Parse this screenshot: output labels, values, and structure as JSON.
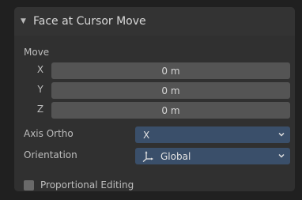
{
  "panel": {
    "title": "Face at Cursor Move",
    "collapse_icon": "disclosure-triangle-down-icon",
    "move": {
      "label": "Move",
      "axes": [
        {
          "label": "X",
          "value": "0 m"
        },
        {
          "label": "Y",
          "value": "0 m"
        },
        {
          "label": "Z",
          "value": "0 m"
        }
      ]
    },
    "axis_ortho": {
      "label": "Axis Ortho",
      "value": "X"
    },
    "orientation": {
      "label": "Orientation",
      "value": "Global",
      "icon": "global-axes-icon"
    },
    "proportional_editing": {
      "label": "Proportional Editing",
      "checked": false
    }
  },
  "colors": {
    "background": "#202020",
    "panel": "#303030",
    "field": "#545454",
    "dropdown": "#3a4f6a",
    "checkbox": "#6a6a6a"
  }
}
